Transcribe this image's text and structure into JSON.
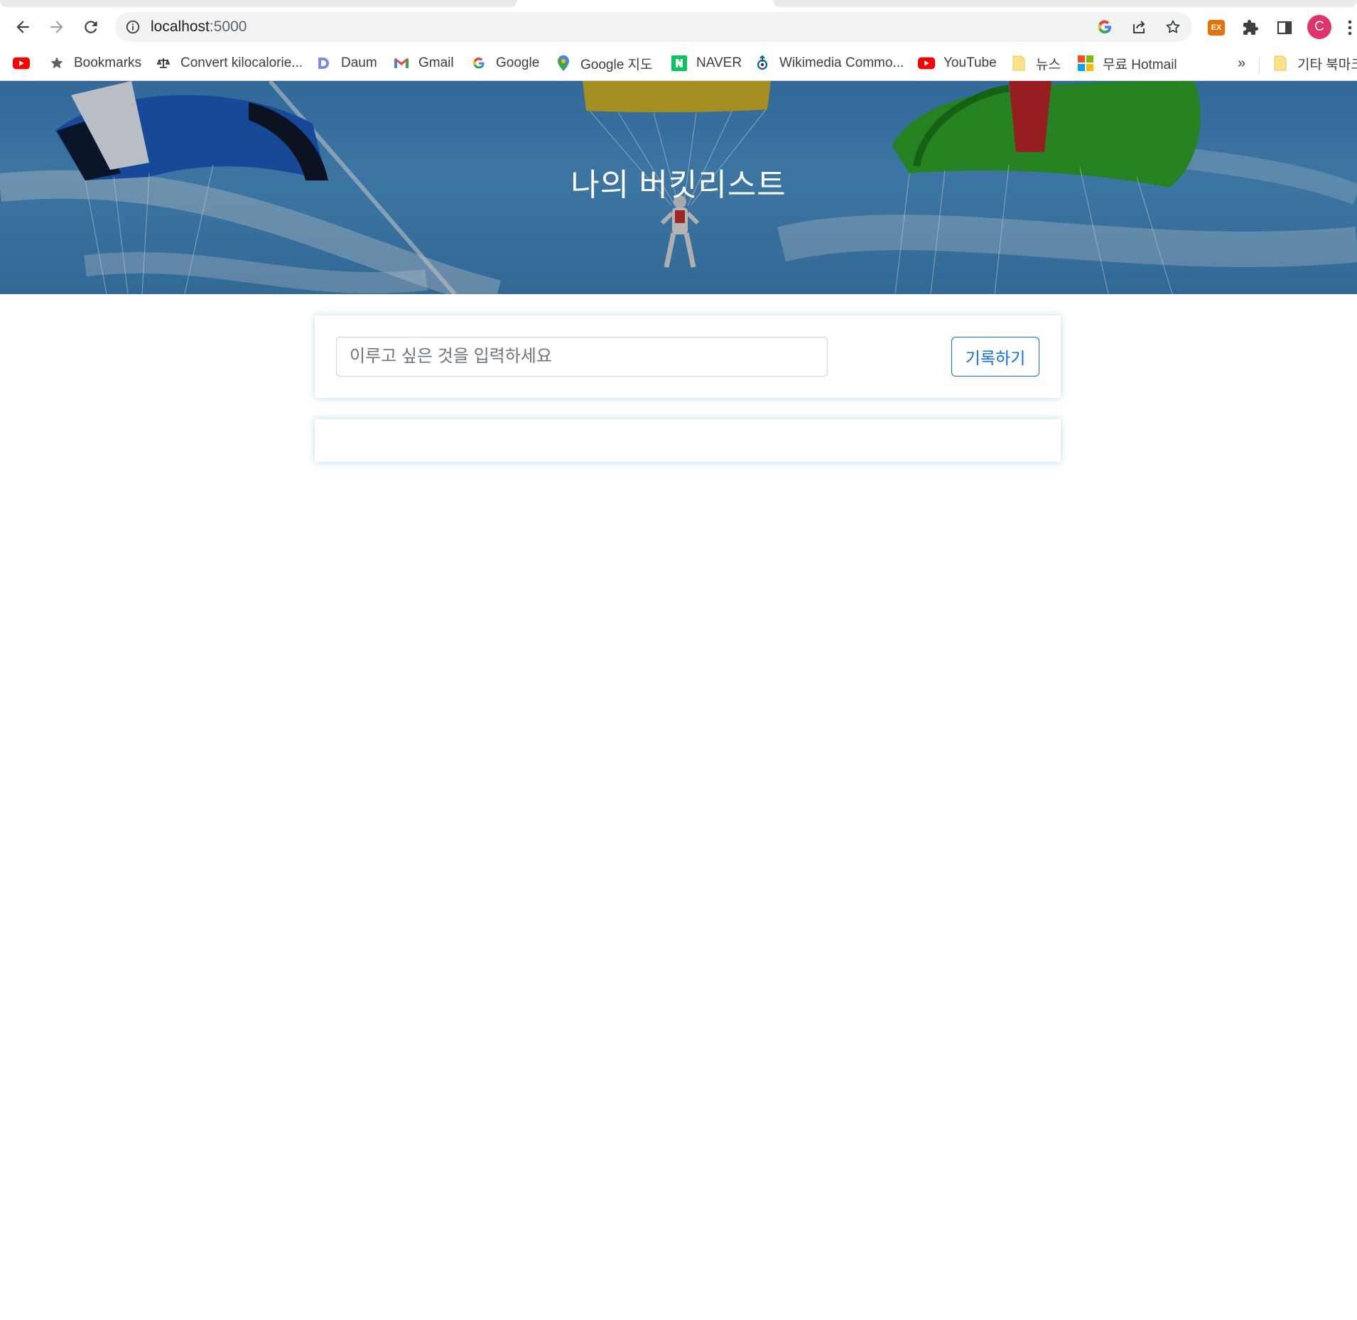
{
  "browser": {
    "url_host": "localhost",
    "url_port": ":5000",
    "profile_initial": "C",
    "extension_label": "EX",
    "overflow_label": "»",
    "bookmarks": [
      {
        "label": "",
        "icon": "youtube-icon"
      },
      {
        "label": "Bookmarks",
        "icon": "star-icon"
      },
      {
        "label": "Convert kilocalorie...",
        "icon": "scale-icon"
      },
      {
        "label": "Daum",
        "icon": "daum-icon"
      },
      {
        "label": "Gmail",
        "icon": "gmail-icon"
      },
      {
        "label": "Google",
        "icon": "google-icon"
      },
      {
        "label": "Google 지도",
        "icon": "maps-pin-icon"
      },
      {
        "label": "NAVER",
        "icon": "naver-icon"
      },
      {
        "label": "Wikimedia Commo...",
        "icon": "wikimedia-icon"
      },
      {
        "label": "YouTube",
        "icon": "youtube-icon"
      },
      {
        "label": "뉴스",
        "icon": "folder-icon"
      },
      {
        "label": "무료 Hotmail",
        "icon": "microsoft-icon"
      }
    ],
    "other_bookmarks": {
      "label": "기타 북마크",
      "icon": "folder-icon"
    }
  },
  "page": {
    "title": "나의 버킷리스트",
    "input": {
      "placeholder": "이루고 싶은 것을 입력하세요",
      "value": ""
    },
    "record_button": "기록하기",
    "bucket_items": []
  },
  "colors": {
    "accent": "#0d6efd",
    "card_glow": "#78bee1",
    "profile": "#e0326b"
  }
}
